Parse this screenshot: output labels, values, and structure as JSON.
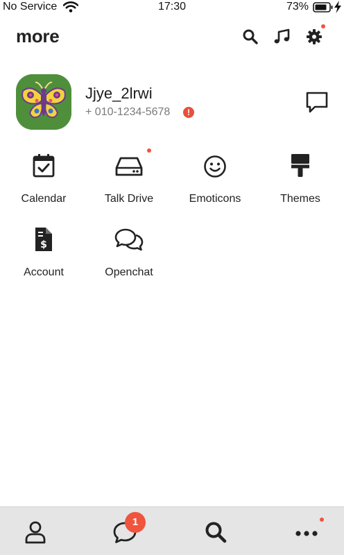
{
  "status_bar": {
    "carrier": "No Service",
    "time": "17:30",
    "battery_percent": "73%",
    "wifi_icon": "wifi-icon",
    "battery_icon": "battery-icon",
    "charging_icon": "charging-bolt-icon"
  },
  "header": {
    "title": "more",
    "actions": [
      {
        "icon": "search-icon"
      },
      {
        "icon": "music-note-icon"
      },
      {
        "icon": "gear-icon",
        "has_notification_dot": true
      }
    ]
  },
  "profile": {
    "name": "Jjye_2lrwi",
    "phone": "+ 010-1234-5678",
    "phone_alert_icon": "alert-icon",
    "alert_symbol": "!",
    "avatar_icon": "butterfly-avatar",
    "chat_icon": "chat-bubble-icon"
  },
  "menu": [
    {
      "label": "Calendar",
      "icon": "calendar-check-icon"
    },
    {
      "label": "Talk Drive",
      "icon": "drive-icon",
      "has_notification_dot": true
    },
    {
      "label": "Emoticons",
      "icon": "smiley-icon"
    },
    {
      "label": "Themes",
      "icon": "paintbrush-icon"
    },
    {
      "label": "Account",
      "icon": "invoice-dollar-icon"
    },
    {
      "label": "Openchat",
      "icon": "chat-bubbles-icon"
    }
  ],
  "tab_bar": {
    "tabs": [
      {
        "icon": "person-icon"
      },
      {
        "icon": "chat-icon",
        "badge": "1"
      },
      {
        "icon": "search-icon"
      },
      {
        "icon": "more-dots-icon",
        "has_notification_dot": true
      }
    ]
  },
  "colors": {
    "accent_red": "#f0543e",
    "tab_bar_bg": "#e5e5e5",
    "avatar_bg": "#4f8f3c"
  }
}
